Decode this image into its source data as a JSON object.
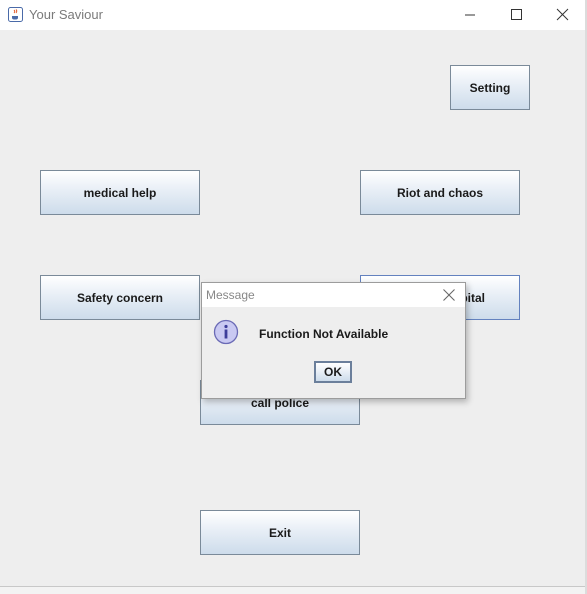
{
  "window": {
    "title": "Your Saviour",
    "icons": {
      "app": "java-cup-icon",
      "minimize": "minimize-icon",
      "maximize": "maximize-icon",
      "close": "close-icon"
    }
  },
  "buttons": {
    "setting": "Setting",
    "medical_help": "medical help",
    "riot_and_chaos": "Riot and chaos",
    "safety_concern": "Safety concern",
    "hospital": "...pital",
    "call_police": "call police",
    "exit": "Exit"
  },
  "dialog": {
    "title": "Message",
    "message": "Function Not Available",
    "ok_label": "OK",
    "icon": "information-icon"
  },
  "colors": {
    "window_bg": "#eeeeee",
    "titlebar_bg": "#ffffff",
    "button_border": "#7a8a99",
    "button_gradient_bottom": "#cddceb",
    "info_icon_fill": "#c9c9f2",
    "info_icon_stroke": "#6a6ab5"
  }
}
